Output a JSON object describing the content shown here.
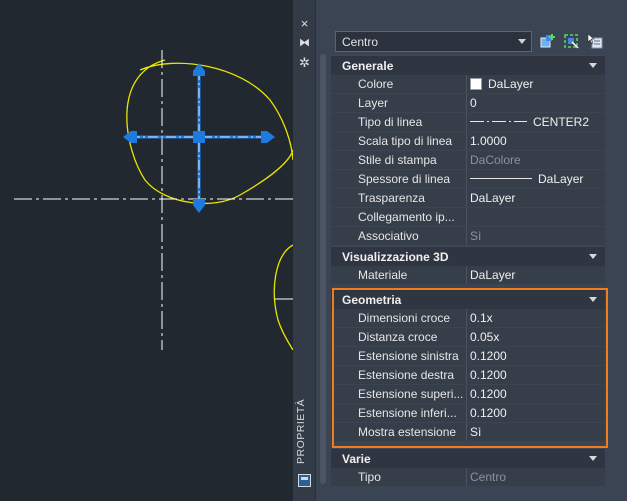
{
  "palette": {
    "strip_label": "PROPRIETÀ",
    "selector_value": "Centro",
    "strip_close": "×",
    "strip_pin": "⧓",
    "strip_gear": "✲"
  },
  "sections": {
    "generale": {
      "title": "Generale",
      "rows": [
        {
          "label": "Colore",
          "value": "DaLayer"
        },
        {
          "label": "Layer",
          "value": "0"
        },
        {
          "label": "Tipo di linea",
          "value": "CENTER2"
        },
        {
          "label": "Scala tipo di linea",
          "value": "1.0000"
        },
        {
          "label": "Stile di stampa",
          "value": "DaColore"
        },
        {
          "label": "Spessore di linea",
          "value": "DaLayer"
        },
        {
          "label": "Trasparenza",
          "value": "DaLayer"
        },
        {
          "label": "Collegamento  ip...",
          "value": ""
        },
        {
          "label": "Associativo",
          "value": "Sì"
        }
      ]
    },
    "vis3d": {
      "title": "Visualizzazione 3D",
      "rows": [
        {
          "label": "Materiale",
          "value": "DaLayer"
        }
      ]
    },
    "geometria": {
      "title": "Geometria",
      "rows": [
        {
          "label": "Dimensioni croce",
          "value": "0.1x"
        },
        {
          "label": "Distanza croce",
          "value": "0.05x"
        },
        {
          "label": "Estensione sinistra",
          "value": "0.1200"
        },
        {
          "label": "Estensione destra",
          "value": "0.1200"
        },
        {
          "label": "Estensione  superi...",
          "value": "0.1200"
        },
        {
          "label": "Estensione  inferi...",
          "value": "0.1200"
        },
        {
          "label": "Mostra estensione",
          "value": "Sì"
        }
      ]
    },
    "varie": {
      "title": "Varie",
      "rows": [
        {
          "label": "Tipo",
          "value": "Centro"
        }
      ]
    }
  },
  "colors": {
    "accent_highlight": "#f07c1c",
    "grip_blue": "#1f7ae0",
    "curve_yellow": "#e6e600"
  },
  "icons": [
    "close-icon",
    "pin-icon",
    "gear-icon",
    "quick-select-icon",
    "select-objects-icon",
    "toggle-pickadd-icon"
  ]
}
